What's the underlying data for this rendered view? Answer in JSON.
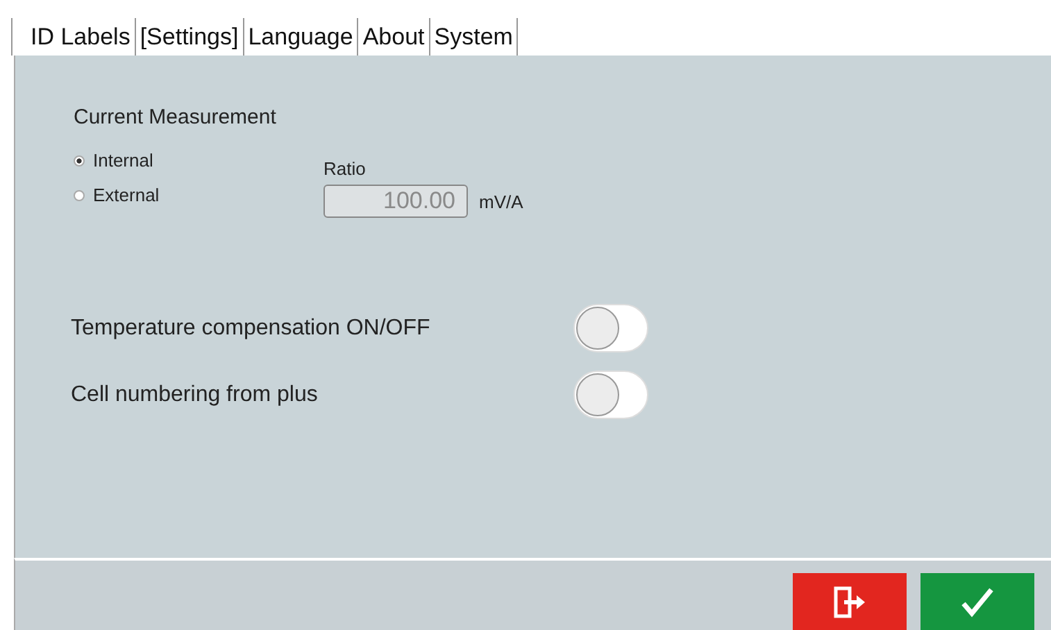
{
  "tabs": [
    {
      "label": "ID Labels"
    },
    {
      "label": "[Settings]"
    },
    {
      "label": "Language"
    },
    {
      "label": "About"
    },
    {
      "label": "System"
    }
  ],
  "current_measurement": {
    "title": "Current Measurement",
    "options": [
      {
        "label": "Internal",
        "selected": true
      },
      {
        "label": "External",
        "selected": false
      }
    ],
    "ratio": {
      "label": "Ratio",
      "value": "100.00",
      "disabled": true,
      "unit": "mV/A"
    }
  },
  "switches": [
    {
      "label": "Temperature compensation ON/OFF",
      "on": false
    },
    {
      "label": "Cell numbering from plus",
      "on": false
    }
  ],
  "buttons": [
    {
      "kind": "exit"
    },
    {
      "kind": "confirm"
    }
  ]
}
